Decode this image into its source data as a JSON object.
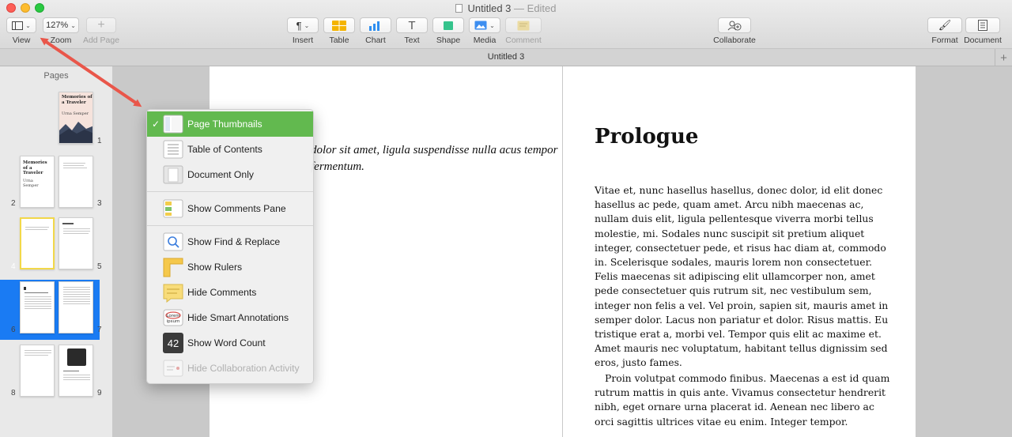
{
  "window": {
    "title": "Untitled 3",
    "edited": "— Edited",
    "tab_title": "Untitled 3"
  },
  "toolbar": {
    "view": "View",
    "zoom_value": "127%",
    "zoom": "Zoom",
    "add_page": "Add Page",
    "insert": "Insert",
    "table": "Table",
    "chart": "Chart",
    "text": "Text",
    "shape": "Shape",
    "media": "Media",
    "comment": "Comment",
    "collaborate": "Collaborate",
    "format": "Format",
    "document": "Document"
  },
  "sidebar": {
    "header": "Pages",
    "cover_title": "Memories of a Traveler",
    "cover_author": "Urna Semper",
    "page_numbers": [
      "1",
      "2",
      "3",
      "4",
      "5",
      "6",
      "7",
      "8",
      "9"
    ]
  },
  "view_menu": {
    "items": [
      {
        "label": "Page Thumbnails",
        "icon": "page-thumbnails-icon",
        "checked": true
      },
      {
        "label": "Table of Contents",
        "icon": "table-of-contents-icon"
      },
      {
        "label": "Document Only",
        "icon": "document-only-icon"
      },
      {
        "label": "Show Comments Pane",
        "icon": "comments-pane-icon"
      },
      {
        "label": "Show Find & Replace",
        "icon": "find-replace-icon"
      },
      {
        "label": "Show Rulers",
        "icon": "rulers-icon"
      },
      {
        "label": "Hide Comments",
        "icon": "comments-icon"
      },
      {
        "label": "Hide Smart Annotations",
        "icon": "smart-annotations-icon"
      },
      {
        "label": "Show Word Count",
        "icon": "word-count-icon",
        "badge": "42"
      },
      {
        "label": "Hide Collaboration Activity",
        "icon": "collaboration-activity-icon",
        "disabled": true
      }
    ]
  },
  "document": {
    "page1_text": "dolor sit amet, ligula suspendisse nulla acus tempor fermentum.",
    "heading": "Prologue",
    "para1": "Vitae et, nunc hasellus hasellus, donec dolor, id elit donec\nhasellus ac pede, quam amet. Arcu nibh maecenas ac,\nnullam duis elit, ligula pellentesque viverra morbi tellus\nmolestie, mi. Sodales nunc suscipit sit pretium aliquet\ninteger, consectetuer pede, et risus hac diam at, commodo\nin. Scelerisque sodales, mauris lorem non consectetuer.\nFelis maecenas sit adipiscing elit ullamcorper non, amet\npede consectetuer quis rutrum sit, nec vestibulum sem,\ninteger non felis a vel. Vel proin, sapien sit, mauris amet in\nsemper dolor. Lacus non pariatur et dolor. Risus mattis. Eu\ntristique erat a, morbi vel. Tempor quis elit ac maxime et.\nAmet mauris nec voluptatum, habitant tellus dignissim sed\neros, justo fames.",
    "para2": "Proin volutpat commodo finibus. Maecenas a est id quam rutrum mattis in quis ante. Vivamus consectetur hendrerit nibh, eget ornare urna placerat id. Aenean nec libero ac orci sagittis ultrices vitae eu enim. Integer tempor."
  },
  "colors": {
    "selection_green": "#62b94f",
    "sidebar_selection": "#1a7bf3",
    "arrow": "#e9564a"
  }
}
